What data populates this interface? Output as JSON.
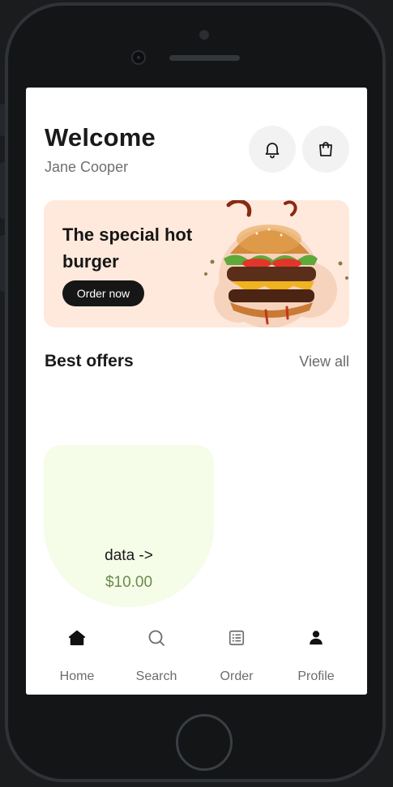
{
  "header": {
    "title": "Welcome",
    "user_name": "Jane Cooper",
    "notification_icon": "bell-icon",
    "cart_icon": "shopping-bag-icon"
  },
  "banner": {
    "title": "The special hot burger",
    "button_label": "Order now"
  },
  "offers": {
    "section_title": "Best offers",
    "view_all_label": "View all",
    "items": [
      {
        "name": "data ->",
        "price": "$10.00"
      }
    ]
  },
  "nav": {
    "items": [
      {
        "label": "Home",
        "icon": "home-icon"
      },
      {
        "label": "Search",
        "icon": "search-icon"
      },
      {
        "label": "Order",
        "icon": "order-list-icon"
      },
      {
        "label": "Profile",
        "icon": "profile-icon"
      }
    ]
  },
  "colors": {
    "banner_background": "#ffe9dc",
    "card_background": "#f5fce7",
    "price": "#6e8a4e",
    "button_dark": "#161616"
  }
}
